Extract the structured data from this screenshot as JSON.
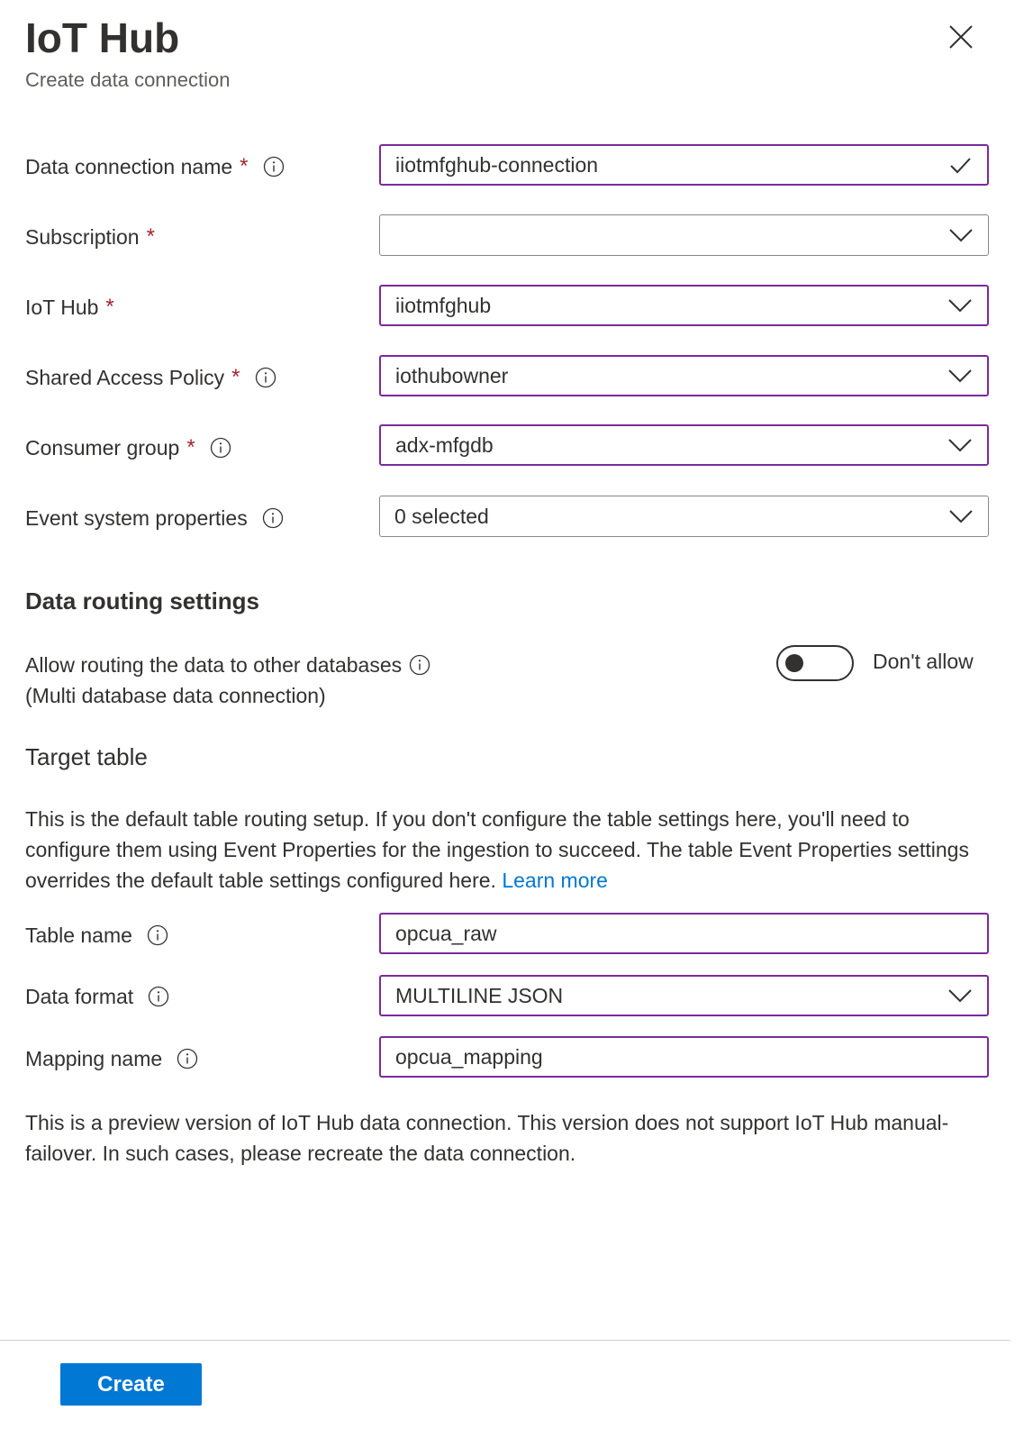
{
  "header": {
    "title": "IoT Hub",
    "subtitle": "Create data connection"
  },
  "form": {
    "data_connection_name": {
      "label": "Data connection name",
      "required": "*",
      "value": "iiotmfghub-connection"
    },
    "subscription": {
      "label": "Subscription",
      "required": "*",
      "value": ""
    },
    "iot_hub": {
      "label": "IoT Hub",
      "required": "*",
      "value": "iiotmfghub"
    },
    "shared_access_policy": {
      "label": "Shared Access Policy",
      "required": "*",
      "value": "iothubowner"
    },
    "consumer_group": {
      "label": "Consumer group",
      "required": "*",
      "value": "adx-mfgdb"
    },
    "event_system_properties": {
      "label": "Event system properties",
      "value": "0 selected"
    }
  },
  "routing": {
    "heading": "Data routing settings",
    "allow_label_line1": "Allow routing the data to other databases",
    "allow_label_line2": "(Multi database data connection)",
    "toggle_label": "Don't allow"
  },
  "target_table": {
    "heading": "Target table",
    "description": "This is the default table routing setup. If you don't configure the table settings here, you'll need to configure them using Event Properties for the ingestion to succeed. The table Event Properties settings overrides the default table settings configured here.",
    "learn_more": "Learn more",
    "table_name": {
      "label": "Table name",
      "value": "opcua_raw"
    },
    "data_format": {
      "label": "Data format",
      "value": "MULTILINE JSON"
    },
    "mapping_name": {
      "label": "Mapping name",
      "value": "opcua_mapping"
    }
  },
  "preview_note": "This is a preview version of IoT Hub data connection. This version does not support IoT Hub manual-failover. In such cases, please recreate the data connection.",
  "footer": {
    "create_label": "Create"
  },
  "colors": {
    "accent": "#0078d4",
    "field_border": "#7a2a9c",
    "required": "#a4262c"
  }
}
